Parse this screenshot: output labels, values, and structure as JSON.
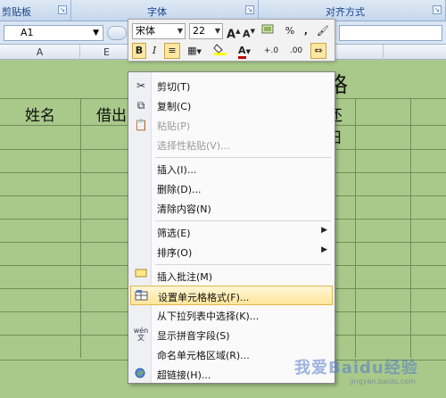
{
  "ribbon": {
    "groups": [
      "剪贴板",
      "字体",
      "对齐方式"
    ]
  },
  "formula_bar": {
    "name_box": "A1"
  },
  "columns": [
    "A",
    "E"
  ],
  "sheet": {
    "title": "登记表格",
    "headers": [
      "姓名",
      "借出",
      "还日"
    ]
  },
  "mini_toolbar": {
    "font": "宋体",
    "size": "22",
    "grow": "A",
    "shrink": "A",
    "percent": "%",
    "comma": ",",
    "bold": "B",
    "italic": "I",
    "font_color_letter": "A",
    "inc_decimal": "+.0",
    "dec_decimal": ".00"
  },
  "context_menu": {
    "items": [
      {
        "label": "剪切(T)",
        "icon": "scissors-icon",
        "enabled": true
      },
      {
        "label": "复制(C)",
        "icon": "copy-icon",
        "enabled": true
      },
      {
        "label": "粘贴(P)",
        "icon": "paste-icon",
        "enabled": false
      },
      {
        "label": "选择性粘贴(V)...",
        "icon": "",
        "enabled": false
      },
      {
        "label": "插入(I)...",
        "icon": "",
        "enabled": true
      },
      {
        "label": "删除(D)...",
        "icon": "",
        "enabled": true
      },
      {
        "label": "清除内容(N)",
        "icon": "",
        "enabled": true
      },
      {
        "label": "筛选(E)",
        "icon": "",
        "enabled": true,
        "submenu": true
      },
      {
        "label": "排序(O)",
        "icon": "",
        "enabled": true,
        "submenu": true
      },
      {
        "label": "插入批注(M)",
        "icon": "comment-icon",
        "enabled": true
      },
      {
        "label": "设置单元格格式(F)...",
        "icon": "format-cells-icon",
        "enabled": true,
        "highlighted": true
      },
      {
        "label": "从下拉列表中选择(K)...",
        "icon": "",
        "enabled": true
      },
      {
        "label": "显示拼音字段(S)",
        "icon": "phonetic-icon",
        "enabled": true
      },
      {
        "label": "命名单元格区域(R)...",
        "icon": "",
        "enabled": true
      },
      {
        "label": "超链接(H)...",
        "icon": "hyperlink-icon",
        "enabled": true
      }
    ]
  },
  "watermark": {
    "text": "我爱Baidu经验",
    "url": "jingyan.baidu.com"
  }
}
